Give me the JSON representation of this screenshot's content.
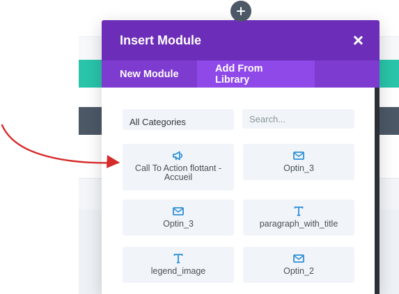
{
  "modal": {
    "title": "Insert Module",
    "tabs": [
      {
        "label": "New Module",
        "active": false
      },
      {
        "label": "Add From Library",
        "active": true
      }
    ]
  },
  "filters": {
    "category_selected": "All Categories",
    "search_placeholder": "Search..."
  },
  "modules": [
    {
      "label": "Call To Action flottant - Accueil",
      "icon": "megaphone-icon"
    },
    {
      "label": "Optin_3",
      "icon": "envelope-icon"
    },
    {
      "label": "Optin_3",
      "icon": "envelope-icon"
    },
    {
      "label": "paragraph_with_title",
      "icon": "text-icon"
    },
    {
      "label": "legend_image",
      "icon": "text-icon"
    },
    {
      "label": "Optin_2",
      "icon": "envelope-icon"
    }
  ],
  "colors": {
    "header": "#6c2eb9",
    "tab_bar": "#7d3bcf",
    "tab_active": "#8f49e8",
    "icon_blue": "#2e8fd6",
    "annotation_red": "#d62b2b",
    "teal_band": "#29c4a9",
    "slate_band": "#4c5866"
  }
}
